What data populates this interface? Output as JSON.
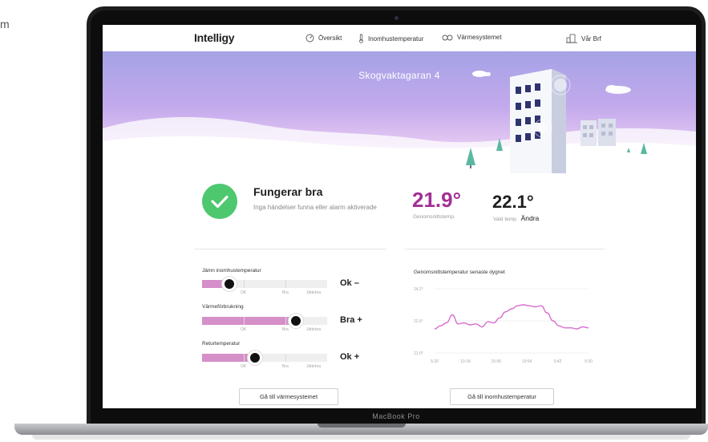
{
  "side_text": "m",
  "device": {
    "label": "MacBook Pro"
  },
  "nav": {
    "logo": "Intelligy",
    "items": [
      {
        "label": "Översikt",
        "icon": "gauge-icon"
      },
      {
        "label": "Inomhustemperatur",
        "icon": "thermometer-icon"
      },
      {
        "label": "Värmesystemet",
        "icon": "infinity-icon"
      },
      {
        "label": "Vår Brf",
        "icon": "building-icon"
      }
    ]
  },
  "hero": {
    "title": "Skogvaktagaran 4"
  },
  "status": {
    "title": "Fungerar bra",
    "subtitle": "Inga händelser funna eller alarm aktiverade",
    "icon": "check-circle-icon",
    "color": "#4dc86f"
  },
  "temps": {
    "average_value": "21.9°",
    "average_label": "Genomsnittstemp.",
    "selected_value": "22.1°",
    "selected_label": "Vald temp.",
    "change_label": "Ändra",
    "accent": "#a32f95"
  },
  "metrics": [
    {
      "label": "Jämn inomhustemperatur",
      "level": 0.22,
      "verdict": "Ok –",
      "scale": [
        "OK",
        "Bra",
        "Jättebra"
      ]
    },
    {
      "label": "Värmeförbrukning",
      "level": 0.75,
      "verdict": "Bra +",
      "scale": [
        "OK",
        "Bra",
        "Jättebra"
      ]
    },
    {
      "label": "Returtemperatur",
      "level": 0.42,
      "verdict": "Ok +",
      "scale": [
        "OK",
        "Bra",
        "Jättebra"
      ]
    }
  ],
  "chart_data": {
    "type": "line",
    "title": "Genomsnittstemperatur senaste dygnet",
    "y_ticks": [
      "24.2°",
      "22.6°",
      "21.0°"
    ],
    "x_ticks": [
      "5:30",
      "10:18",
      "15:06",
      "19:54",
      "0:42",
      "5:30"
    ],
    "ylim": [
      21.0,
      24.2
    ],
    "color": "#d96fd0",
    "series": [
      {
        "values": [
          22.2,
          22.35,
          22.5,
          22.9,
          22.45,
          22.5,
          22.4,
          22.45,
          22.3,
          22.55,
          22.5,
          22.75,
          23.05,
          23.2,
          23.35,
          23.4,
          23.35,
          23.3,
          23.35,
          23.0,
          22.6,
          22.35,
          22.25,
          22.25,
          22.2,
          22.3,
          22.25
        ]
      }
    ]
  },
  "buttons": {
    "heating_system": "Gå till värmesystemet",
    "indoor_temp": "Gå till inomhustemperatur"
  }
}
